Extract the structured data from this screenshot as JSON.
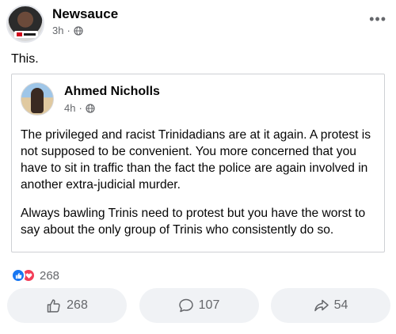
{
  "post": {
    "author": "Newsauce",
    "time": "3h",
    "separator": "·",
    "more_icon": "more-horizontal-icon",
    "text": "This."
  },
  "shared": {
    "author": "Ahmed Nicholls",
    "time": "4h",
    "separator": "·",
    "paragraphs": [
      "The privileged and racist Trinidadians are at it again. A protest is not supposed to be convenient. You more concerned that you have to sit in traffic than the fact the police are again involved in another extra-judicial murder.",
      "Always bawling Trinis need to protest but you have the worst to say about the only group of Trinis who consistently do so."
    ]
  },
  "reactions": {
    "count": "268",
    "like_color": "#1877f2",
    "love_color": "#f33e58"
  },
  "actions": {
    "like_count": "268",
    "comment_count": "107",
    "share_count": "54"
  }
}
